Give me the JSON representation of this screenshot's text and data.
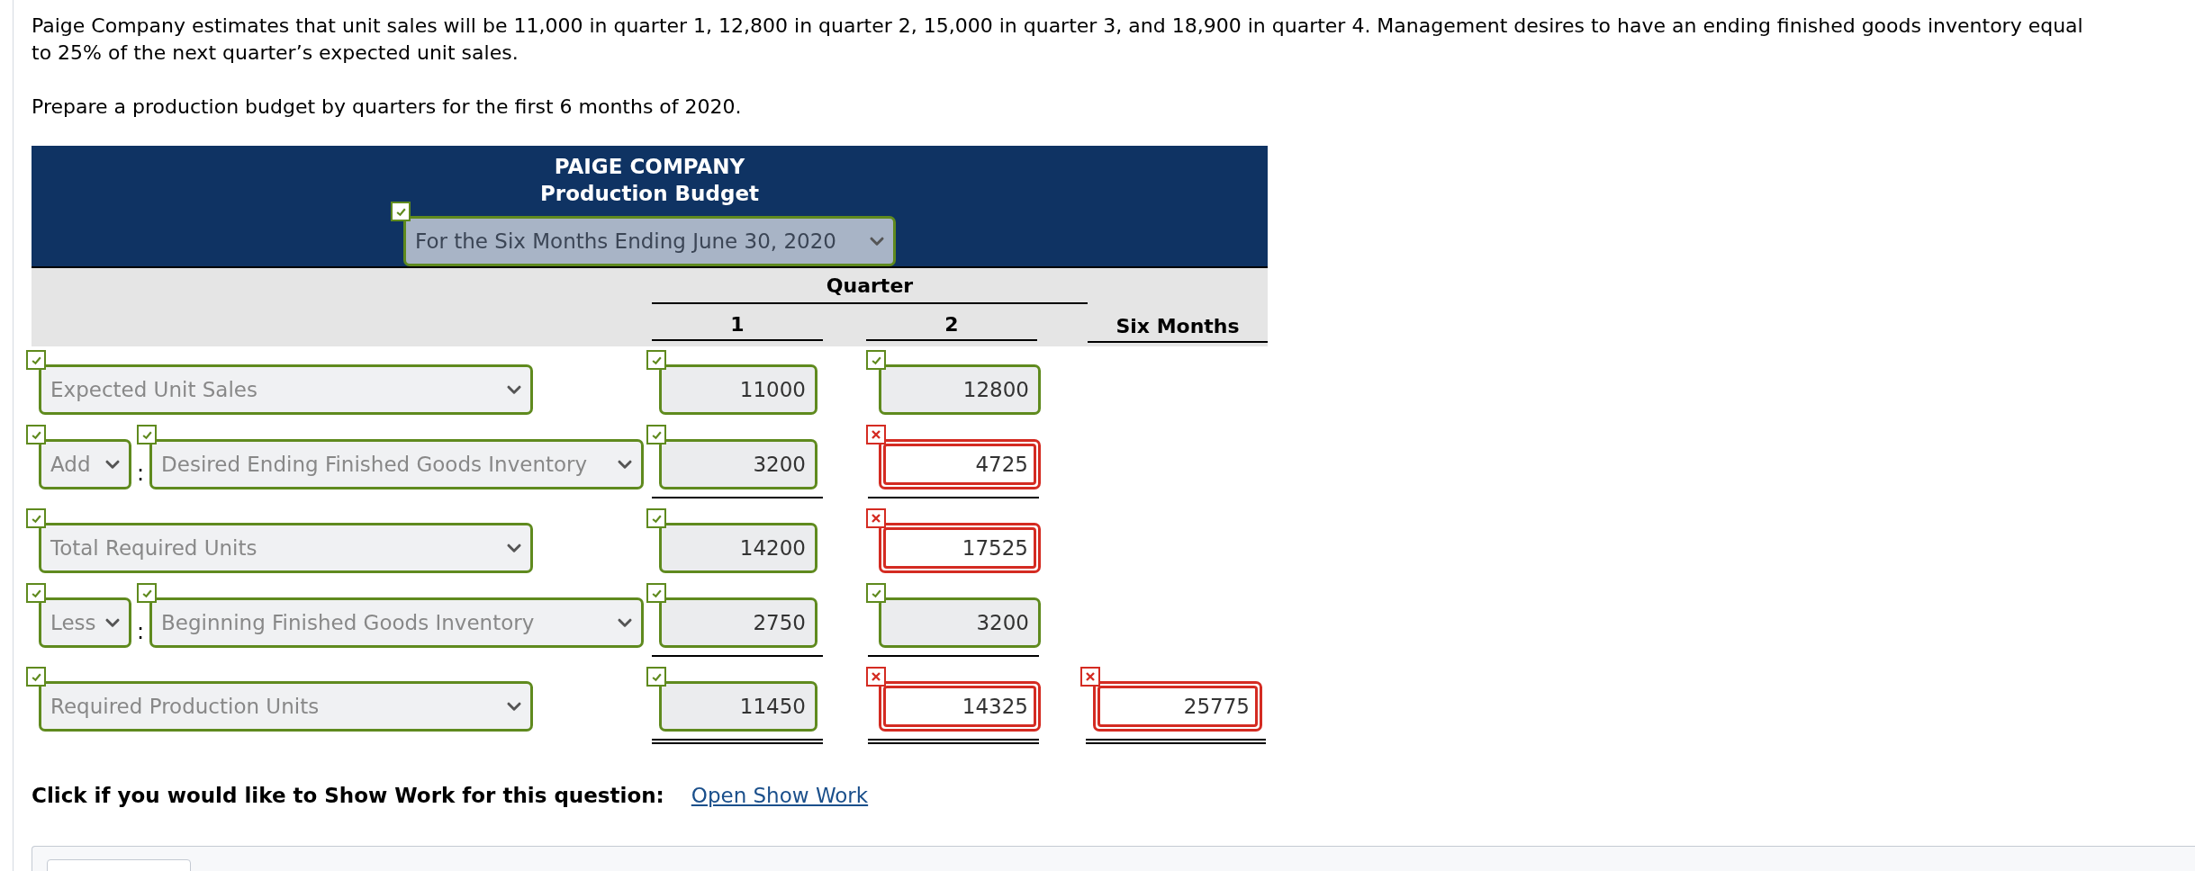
{
  "intro": [
    "Paige Company estimates that unit sales will be 11,000 in quarter 1, 12,800 in quarter 2, 15,000 in quarter 3, and 18,900 in quarter 4. Management desires to have an ending finished goods inventory equal to 25% of the next quarter’s expected unit sales.",
    "Prepare a production budget by quarters for the first 6 months of 2020."
  ],
  "table": {
    "company": "PAIGE COMPANY",
    "title": "Production Budget",
    "period": {
      "value": "For the Six Months Ending June 30, 2020",
      "correct": true
    },
    "group_header": "Quarter",
    "columns": [
      "1",
      "2",
      "Six Months"
    ],
    "rows": [
      {
        "kind": "single",
        "label": {
          "value": "Expected Unit Sales",
          "correct": true
        },
        "cells": [
          {
            "value": "11000",
            "correct": true
          },
          {
            "value": "12800",
            "correct": true
          }
        ],
        "ruled": false
      },
      {
        "kind": "operator",
        "operator": {
          "value": "Add",
          "correct": true
        },
        "separator": ":",
        "label": {
          "value": "Desired Ending Finished Goods Inventory",
          "correct": true
        },
        "cells": [
          {
            "value": "3200",
            "correct": true
          },
          {
            "value": "4725",
            "correct": false
          }
        ],
        "ruled": true,
        "double": false
      },
      {
        "kind": "single",
        "label": {
          "value": "Total Required Units",
          "correct": true
        },
        "cells": [
          {
            "value": "14200",
            "correct": true
          },
          {
            "value": "17525",
            "correct": false
          }
        ],
        "ruled": false
      },
      {
        "kind": "operator",
        "operator": {
          "value": "Less",
          "correct": true
        },
        "separator": ":",
        "label": {
          "value": "Beginning Finished Goods Inventory",
          "correct": true
        },
        "cells": [
          {
            "value": "2750",
            "correct": true
          },
          {
            "value": "3200",
            "correct": true
          }
        ],
        "ruled": true,
        "double": false
      },
      {
        "kind": "single",
        "label": {
          "value": "Required Production Units",
          "correct": true
        },
        "cells": [
          {
            "value": "11450",
            "correct": true
          },
          {
            "value": "14325",
            "correct": false
          },
          {
            "value": "25775",
            "correct": false
          }
        ],
        "ruled": true,
        "double": true
      }
    ]
  },
  "show_work": {
    "prompt": "Click if you would like to Show Work for this question:",
    "link": "Open Show Work"
  }
}
